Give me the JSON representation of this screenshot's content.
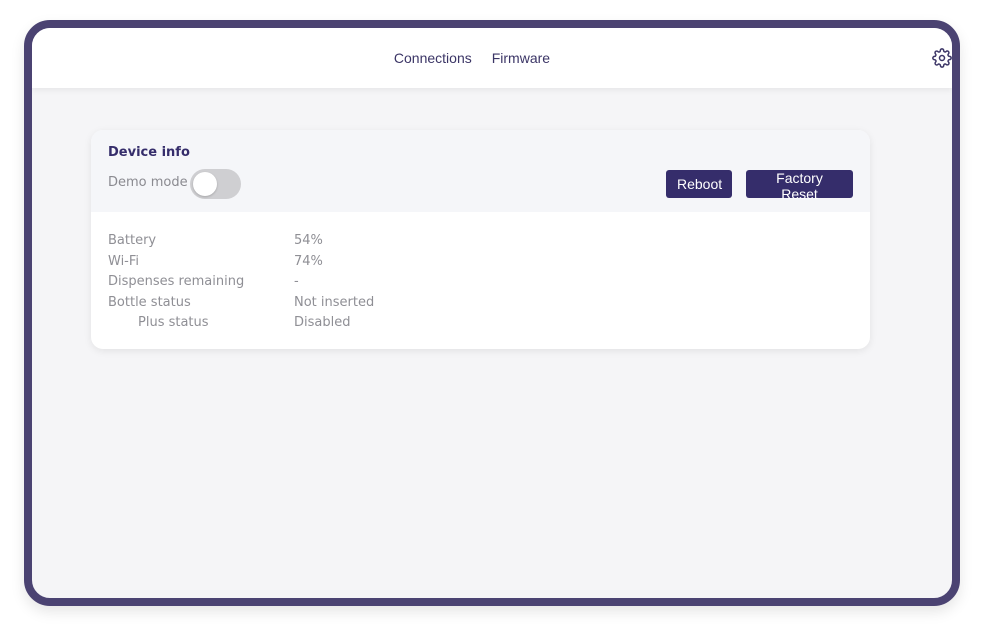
{
  "nav": {
    "links": [
      "Connections",
      "Firmware"
    ],
    "settings_icon": "gear-icon"
  },
  "card": {
    "title": "Device info",
    "demo_mode_label": "Demo mode",
    "demo_mode_on": false,
    "buttons": {
      "reboot": "Reboot",
      "factory_reset": "Factory Reset"
    },
    "info": [
      {
        "label": "Battery",
        "value": "54%"
      },
      {
        "label": "Wi-Fi",
        "value": "74%"
      },
      {
        "label": "Dispenses remaining",
        "value": "-"
      },
      {
        "label": "Bottle status",
        "value": "Not inserted"
      },
      {
        "label": "Plus status",
        "value": "Disabled"
      }
    ]
  },
  "colors": {
    "frame": "#4b4372",
    "accent": "#352d6b",
    "nav_text": "#3b3566",
    "muted_text": "#8f8f95",
    "toggle_off": "#cfcfd2"
  }
}
